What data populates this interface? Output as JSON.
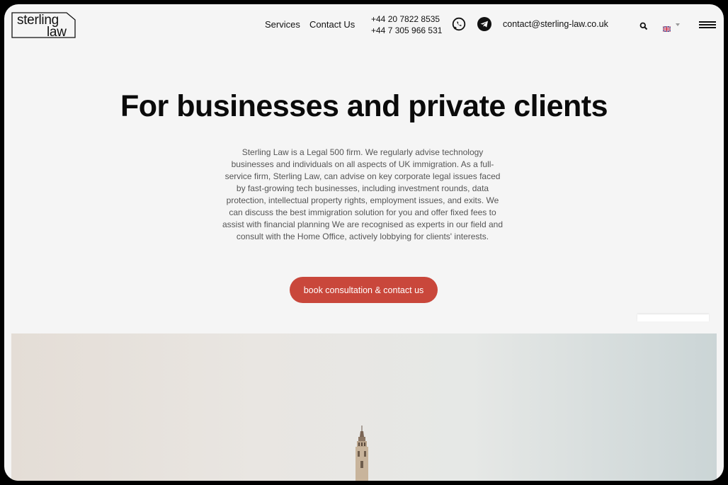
{
  "header": {
    "logo_line1": "sterling",
    "logo_line2": "law",
    "nav": [
      {
        "label": "Services"
      },
      {
        "label": "Contact Us"
      }
    ],
    "phones": [
      "+44 20 7822 8535",
      "+44 7 305 966 531"
    ],
    "email": "contact@sterling-law.co.uk",
    "icons": [
      "whatsapp-icon",
      "telegram-icon",
      "search-icon",
      "uk-flag-icon",
      "chevron-down-icon",
      "hamburger-menu-icon"
    ]
  },
  "hero": {
    "title": "For businesses and private clients",
    "description": "Sterling Law is a Legal 500 firm. We regularly advise technology businesses and individuals on all aspects of UK immigration. As a full-service firm, Sterling Law, can advise on key corporate legal issues faced by fast-growing tech businesses, including investment rounds, data protection, intellectual property rights, employment issues, and exits. We can discuss the best immigration solution for you and offer fixed fees to assist with financial planning We are recognised as experts in our field and consult with the Home Office, actively lobbying for clients' interests.",
    "cta_label": "book consultation & contact us"
  },
  "colors": {
    "accent": "#c9473b",
    "background": "#f5f5f5",
    "text": "#0b0b0b"
  }
}
